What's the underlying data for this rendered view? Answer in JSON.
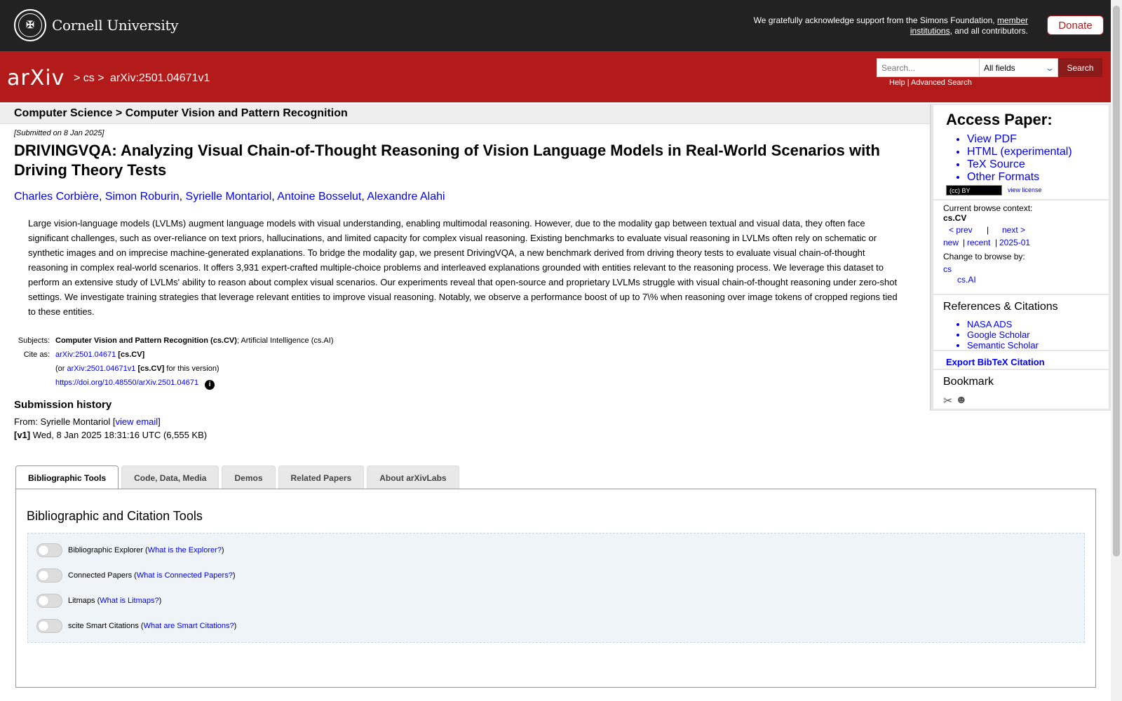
{
  "cornell": {
    "name": "Cornell University",
    "ack_text": "We gratefully acknowledge support from the Simons Foundation,",
    "ack_link": "member institutions",
    "ack_tail": ", and all contributors.",
    "donate_label": "Donate"
  },
  "header": {
    "logo": "arXiv",
    "crumb_1": "> cs >",
    "crumb_2": "arXiv:2501.04671v1",
    "search_placeholder": "Search...",
    "field_select": "All fields",
    "search_button": "Search",
    "help": "Help",
    "separator": "|",
    "advanced": "Advanced Search"
  },
  "subject_bar": "Computer Science > Computer Vision and Pattern Recognition",
  "dateline": "[Submitted on 8 Jan 2025]",
  "paper": {
    "title": "DRIVINGVQA: Analyzing Visual Chain-of-Thought Reasoning of Vision Language Models in Real-World Scenarios with Driving Theory Tests",
    "authors": [
      "Charles Corbière",
      "Simon Roburin",
      "Syrielle Montariol",
      "Antoine Bosselut",
      "Alexandre Alahi"
    ],
    "abstract": "Large vision-language models (LVLMs) augment language models with visual understanding, enabling multimodal reasoning. However, due to the modality gap between textual and visual data, they often face significant challenges, such as over-reliance on text priors, hallucinations, and limited capacity for complex visual reasoning. Existing benchmarks to evaluate visual reasoning in LVLMs often rely on schematic or synthetic images and on imprecise machine-generated explanations. To bridge the modality gap, we present DrivingVQA, a new benchmark derived from driving theory tests to evaluate visual chain-of-thought reasoning in complex real-world scenarios. It offers 3,931 expert-crafted multiple-choice problems and interleaved explanations grounded with entities relevant to the reasoning process. We leverage this dataset to perform an extensive study of LVLMs' ability to reason about complex visual scenarios. Our experiments reveal that open-source and proprietary LVLMs struggle with visual chain-of-thought reasoning under zero-shot settings. We investigate training strategies that leverage relevant entities to improve visual reasoning. Notably, we observe a performance boost of up to 7\\% when reasoning over image tokens of cropped regions tied to these entities."
  },
  "meta": {
    "subjects_label": "Subjects:",
    "subjects_primary": "Computer Vision and Pattern Recognition (cs.CV)",
    "subjects_rest": "; Artificial Intelligence (cs.AI)",
    "cite_label": "Cite as:",
    "cite_id": "arXiv:2501.04671",
    "cite_cat": "[cs.CV]",
    "cite_or_open": "(or",
    "cite_version_id": "arXiv:2501.04671v1",
    "cite_version_tail": "for this version)",
    "doi": "https://doi.org/10.48550/arXiv.2501.04671",
    "doi_info_icon": "i"
  },
  "history": {
    "title": "Submission history",
    "from_label": "From: Syrielle Montariol [",
    "view_email": "view email",
    "from_close": "]",
    "v1_label": "[v1]",
    "v1_text": "Wed, 8 Jan 2025 18:31:16 UTC (6,555 KB)"
  },
  "sidebar": {
    "access_title": "Access Paper:",
    "access_links": [
      "View PDF",
      "HTML (experimental)",
      "TeX Source",
      "Other Formats"
    ],
    "cc_badge": "(cc) BY",
    "view_license": "view license",
    "ctx_label": "Current browse context:",
    "ctx_value": "cs.CV",
    "prev": "< prev",
    "pipe": "|",
    "next": "next >",
    "new": "new",
    "recent": "recent",
    "month": "2025-01",
    "change_label": "Change to browse by:",
    "browse_cs": "cs",
    "browse_csai": "cs.AI",
    "refs_title": "References & Citations",
    "refs": [
      "NASA ADS",
      "Google Scholar",
      "Semantic Scholar"
    ],
    "bibtex": "Export BibTeX Citation",
    "bookmark_title": "Bookmark",
    "bookmark_icons": [
      "bibsonomy-icon",
      "reddit-icon"
    ]
  },
  "tabs": [
    "Bibliographic Tools",
    "Code, Data, Media",
    "Demos",
    "Related Papers",
    "About arXivLabs"
  ],
  "panel": {
    "title": "Bibliographic and Citation Tools",
    "tools": [
      {
        "label": "Bibliographic Explorer",
        "link": "What is the Explorer?"
      },
      {
        "label": "Connected Papers",
        "link": "What is Connected Papers?"
      },
      {
        "label": "Litmaps",
        "link": "What is Litmaps?"
      },
      {
        "label": "scite Smart Citations",
        "link": "What are Smart Citations?"
      }
    ]
  },
  "colors": {
    "arxiv_red": "#b31b1b",
    "cornell_dark": "#222222",
    "link_blue": "#0000ee"
  }
}
